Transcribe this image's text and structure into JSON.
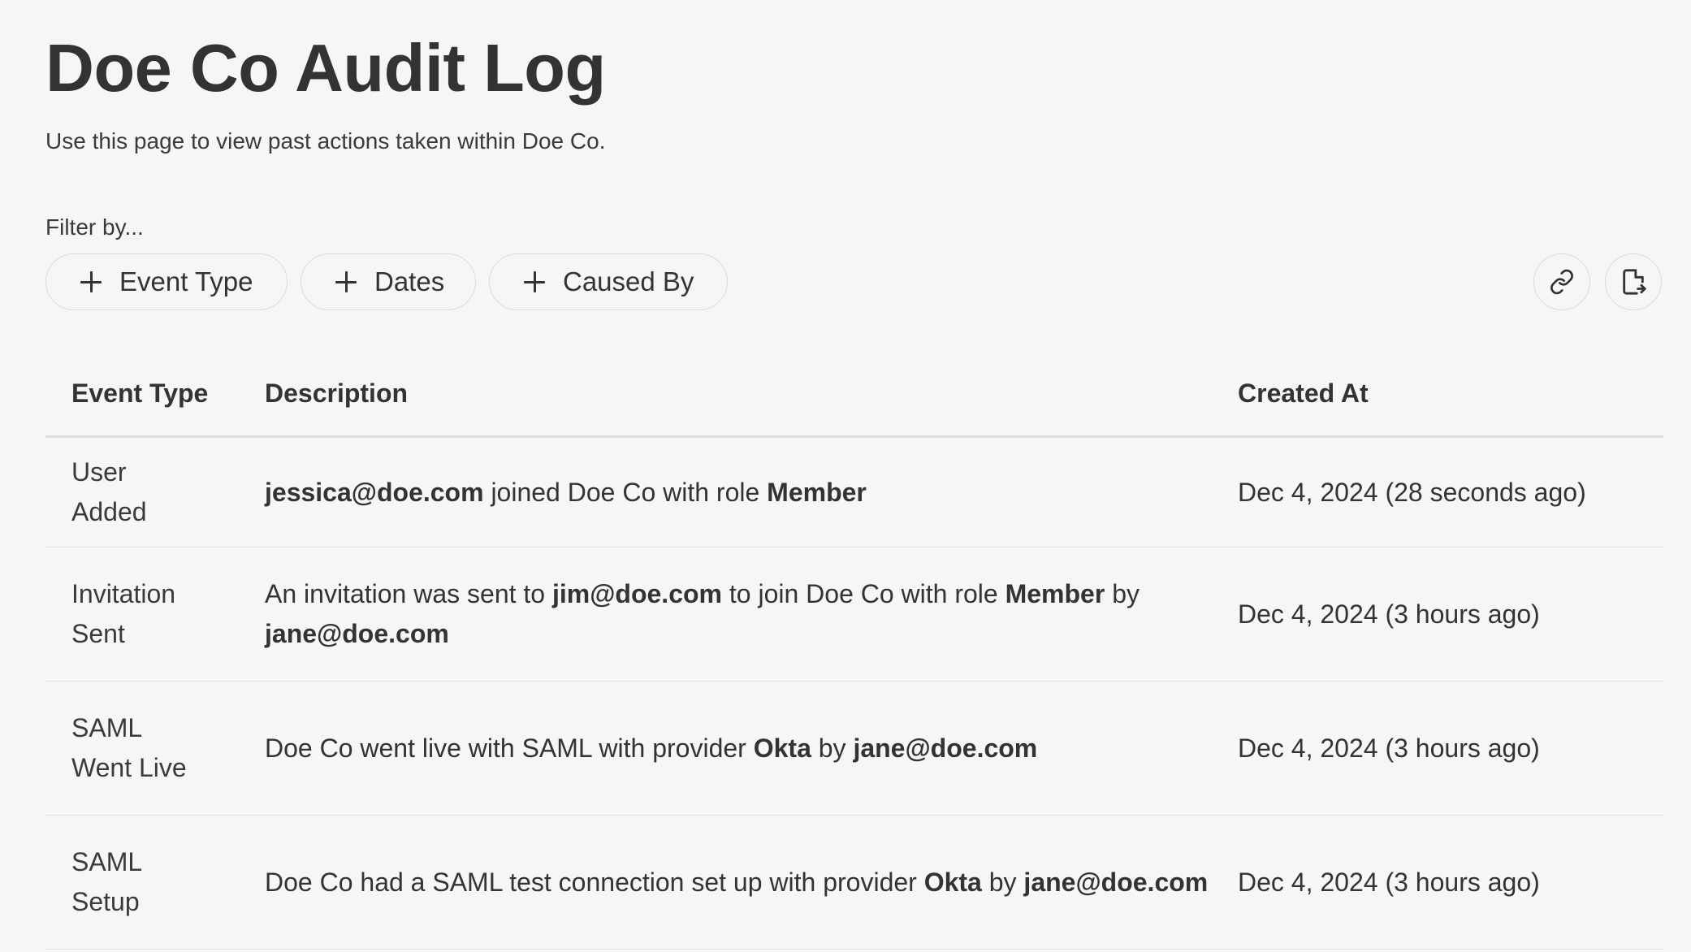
{
  "page": {
    "title": "Doe Co Audit Log",
    "subtitle": "Use this page to view past actions taken within Doe Co."
  },
  "filters": {
    "label": "Filter by...",
    "chips": [
      {
        "label": "Event Type",
        "icon": "plus-icon"
      },
      {
        "label": "Dates",
        "icon": "plus-icon"
      },
      {
        "label": "Caused By",
        "icon": "plus-icon"
      }
    ],
    "actions": [
      {
        "icon": "link-icon"
      },
      {
        "icon": "export-file-icon"
      }
    ]
  },
  "table": {
    "headers": {
      "event_type": "Event Type",
      "description": "Description",
      "created_at": "Created At"
    },
    "rows": [
      {
        "event_type": "User Added",
        "description": {
          "p0": "jessica@doe.com",
          "p1": " joined Doe Co with role ",
          "p2": "Member"
        },
        "created_at": "Dec 4, 2024 (28 seconds ago)"
      },
      {
        "event_type": "Invitation Sent",
        "description": {
          "p0": "An invitation was sent to ",
          "p1": "jim@doe.com",
          "p2": " to join Doe Co with role ",
          "p3": "Member",
          "p4": " by ",
          "p5": "jane@doe.com"
        },
        "created_at": "Dec 4, 2024 (3 hours ago)"
      },
      {
        "event_type": "SAML Went Live",
        "description": {
          "p0": "Doe Co went live with SAML with provider ",
          "p1": "Okta",
          "p2": " by ",
          "p3": "jane@doe.com"
        },
        "created_at": "Dec 4, 2024 (3 hours ago)"
      },
      {
        "event_type": "SAML Setup",
        "description": {
          "p0": "Doe Co had a SAML test connection set up with provider ",
          "p1": "Okta",
          "p2": " by ",
          "p3": "jane@doe.com"
        },
        "created_at": "Dec 4, 2024 (3 hours ago)"
      }
    ]
  },
  "colors": {
    "background": "#f6f6f6",
    "text": "#333333",
    "border": "#dcdcdc"
  }
}
